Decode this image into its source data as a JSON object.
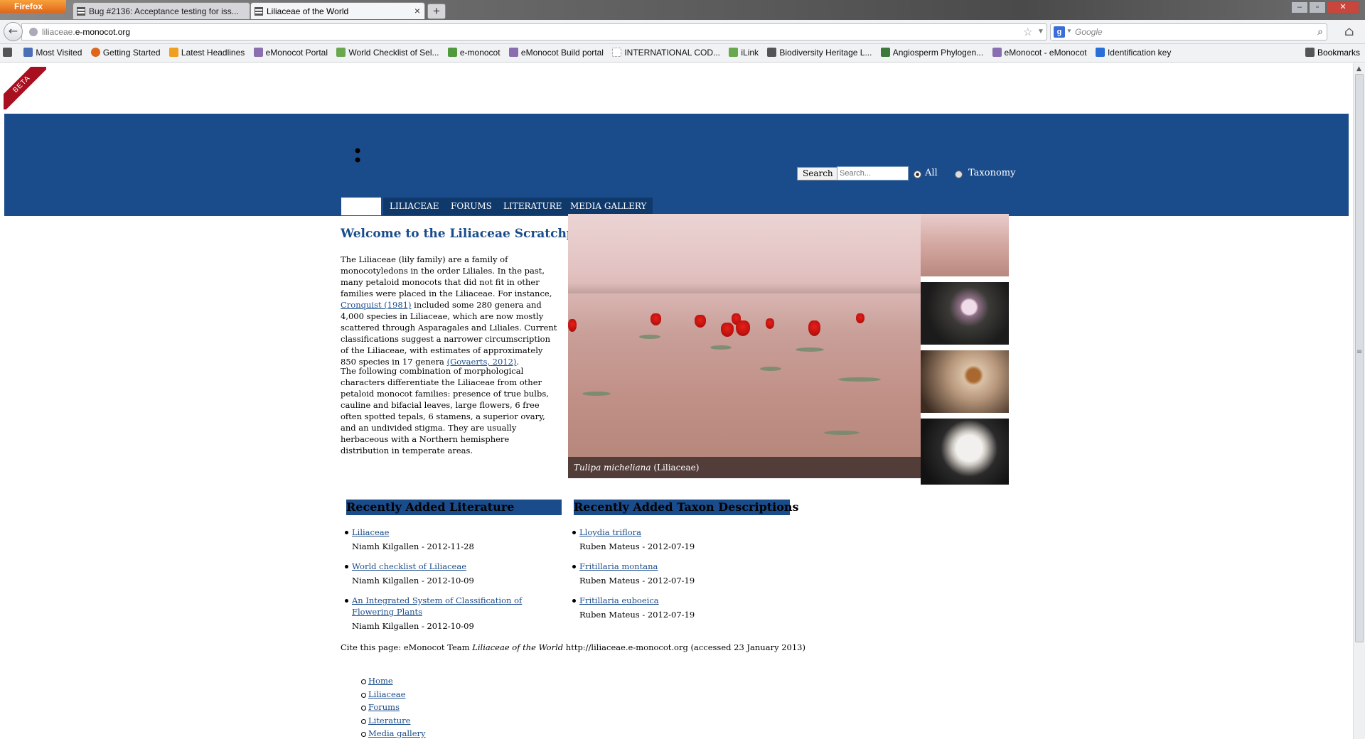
{
  "browser": {
    "app_button": "Firefox",
    "tabs": [
      {
        "title": "Bug #2136: Acceptance testing for iss..."
      },
      {
        "title": "Liliaceae of the World"
      }
    ],
    "url_dim": "liliaceae.",
    "url_main": "e-monocot.org",
    "search_placeholder": "Google",
    "bookmarks": [
      {
        "label": "Most Visited",
        "icon": "most-visited-icon",
        "color": "#4a6fb5"
      },
      {
        "label": "Getting Started",
        "icon": "firefox-icon",
        "color": "#e0661a"
      },
      {
        "label": "Latest Headlines",
        "icon": "rss-icon",
        "color": "#f0a020"
      },
      {
        "label": "eMonocot Portal",
        "icon": "emonocot-icon",
        "color": "#8a6fb0"
      },
      {
        "label": "World Checklist of Sel...",
        "icon": "kew-icon",
        "color": "#6aa84f"
      },
      {
        "label": "e-monocot",
        "icon": "emonocot-square-icon",
        "color": "#4f9a3c"
      },
      {
        "label": "eMonocot Build portal",
        "icon": "emonocot-icon",
        "color": "#8a6fb0"
      },
      {
        "label": "INTERNATIONAL COD...",
        "icon": "blank-page-icon",
        "color": "#ffffff"
      },
      {
        "label": "iLink",
        "icon": "kew-icon",
        "color": "#6aa84f"
      },
      {
        "label": "Biodiversity Heritage L...",
        "icon": "bhl-icon",
        "color": "#555555"
      },
      {
        "label": "Angiosperm Phylogen...",
        "icon": "apg-icon",
        "color": "#3b7a3b"
      },
      {
        "label": "eMonocot - eMonocot",
        "icon": "emonocot-icon",
        "color": "#8a6fb0"
      },
      {
        "label": "Identification key",
        "icon": "lis-icon",
        "color": "#2a6fd9"
      }
    ],
    "bookmarks_menu": "Bookmarks"
  },
  "site": {
    "beta": "BETA",
    "search_button": "Search",
    "search_placeholder": "Search...",
    "radio_all": "All",
    "radio_taxonomy": "Taxonomy",
    "nav": [
      "",
      "LILIACEAE",
      "FORUMS",
      "LITERATURE",
      "MEDIA GALLERY"
    ]
  },
  "content": {
    "title": "Welcome to the Liliaceae Scratchpad",
    "p1_a": "The Liliaceae (lily family) are a family of monocotyledons in the order Liliales. In the past, many petaloid monocots that did not fit in other families were placed in the Liliaceae. For instance, ",
    "p1_link1": "Cronquist (1981)",
    "p1_b": " included some 280 genera and 4,000 species in Liliaceae, which are now mostly scattered through Asparagales and Liliales. Current classifications suggest a narrower circumscription of the Liliaceae, with estimates of approximately 850 species in 17 genera ",
    "p1_link2": "(Govaerts, 2012)",
    "p1_c": ".",
    "p2": "The following combination of morphological characters differentiate the Liliaceae from other petaloid monocot families: presence of true bulbs, cauline and bifacial leaves, large flowers, 6 free often spotted tepals, 6 stamens, a superior ovary, and an undivided stigma. They are usually herbaceous with a Northern hemisphere distribution in temperate areas.",
    "hero_caption_species": "Tulipa micheliana",
    "hero_caption_family": " (Liliaceae)"
  },
  "literature": {
    "heading": "Recently Added Literature",
    "items": [
      {
        "title": "Liliaceae",
        "byline": "Niamh Kilgallen - 2012-11-28"
      },
      {
        "title": "World checklist of Liliaceae",
        "byline": "Niamh Kilgallen - 2012-10-09"
      },
      {
        "title": "An Integrated System of Classification of Flowering Plants",
        "byline": "Niamh Kilgallen - 2012-10-09"
      }
    ]
  },
  "taxa": {
    "heading": "Recently Added Taxon Descriptions",
    "items": [
      {
        "title": "Lloydia triflora",
        "byline": "Ruben Mateus - 2012-07-19"
      },
      {
        "title": "Fritillaria montana",
        "byline": "Ruben Mateus - 2012-07-19"
      },
      {
        "title": "Fritillaria euboeica",
        "byline": "Ruben Mateus - 2012-07-19"
      }
    ]
  },
  "cite": {
    "prefix": "Cite this page: eMonocot Team ",
    "title": "Liliaceae of the World",
    "suffix": " http://liliaceae.e-monocot.org (accessed 23 January 2013)"
  },
  "footer": [
    "Home",
    "Liliaceae",
    "Forums",
    "Literature",
    "Media gallery"
  ],
  "colors": {
    "header": "#1a4c8b",
    "nav_tab": "#10396b",
    "beta": "#a80f1f"
  }
}
